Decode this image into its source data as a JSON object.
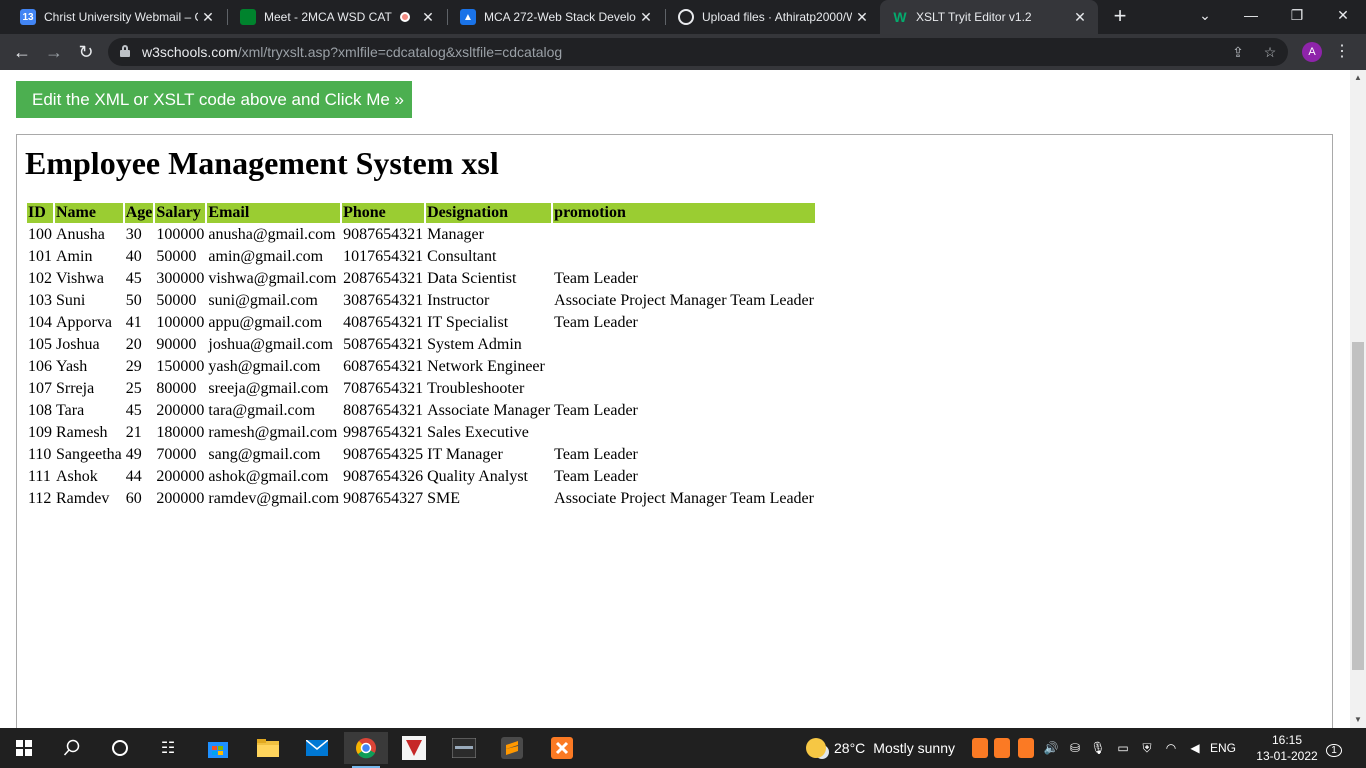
{
  "browser": {
    "tabs": [
      {
        "title": "Christ University Webmail – C",
        "favicon": "calendar-icon",
        "favicon_text": "13"
      },
      {
        "title": "Meet - 2MCA WSD CAT",
        "favicon": "meet-icon"
      },
      {
        "title": "MCA 272-Web Stack Develop",
        "favicon": "classroom-icon"
      },
      {
        "title": "Upload files · Athiratp2000/W",
        "favicon": "github-icon"
      },
      {
        "title": "XSLT Tryit Editor v1.2",
        "favicon": "w3schools-icon",
        "active": true
      }
    ],
    "url_host": "w3schools.com",
    "url_path": "/xml/tryxslt.asp?xmlfile=cdcatalog&xsltfile=cdcatalog",
    "profile_initial": "A"
  },
  "page": {
    "run_button_label": "Edit the XML or XSLT code above and Click Me »",
    "result_title": "Employee Management System xsl",
    "table": {
      "columns": [
        "ID",
        "Name",
        "Age",
        "Salary",
        "Email",
        "Phone",
        "Designation",
        "promotion"
      ],
      "rows": [
        [
          "100",
          "Anusha",
          "30",
          "100000",
          "anusha@gmail.com",
          "9087654321",
          "Manager",
          ""
        ],
        [
          "101",
          "Amin",
          "40",
          "50000",
          "amin@gmail.com",
          "1017654321",
          "Consultant",
          ""
        ],
        [
          "102",
          "Vishwa",
          "45",
          "300000",
          "vishwa@gmail.com",
          "2087654321",
          "Data Scientist",
          "Team Leader"
        ],
        [
          "103",
          "Suni",
          "50",
          "50000",
          "suni@gmail.com",
          "3087654321",
          "Instructor",
          "Associate Project Manager Team Leader"
        ],
        [
          "104",
          "Apporva",
          "41",
          "100000",
          "appu@gmail.com",
          "4087654321",
          "IT Specialist",
          "Team Leader"
        ],
        [
          "105",
          "Joshua",
          "20",
          "90000",
          "joshua@gmail.com",
          "5087654321",
          "System Admin",
          ""
        ],
        [
          "106",
          "Yash",
          "29",
          "150000",
          "yash@gmail.com",
          "6087654321",
          "Network Engineer",
          ""
        ],
        [
          "107",
          "Srreja",
          "25",
          "80000",
          "sreeja@gmail.com",
          "7087654321",
          "Troubleshooter",
          ""
        ],
        [
          "108",
          "Tara",
          "45",
          "200000",
          "tara@gmail.com",
          "8087654321",
          "Associate Manager",
          "Team Leader"
        ],
        [
          "109",
          "Ramesh",
          "21",
          "180000",
          "ramesh@gmail.com",
          "9987654321",
          "Sales Executive",
          ""
        ],
        [
          "110",
          "Sangeetha",
          "49",
          "70000",
          "sang@gmail.com",
          "9087654325",
          "IT Manager",
          "Team Leader"
        ],
        [
          "111",
          "Ashok",
          "44",
          "200000",
          "ashok@gmail.com",
          "9087654326",
          "Quality Analyst",
          "Team Leader"
        ],
        [
          "112",
          "Ramdev",
          "60",
          "200000",
          "ramdev@gmail.com",
          "9087654327",
          "SME",
          "Associate Project Manager Team Leader"
        ]
      ]
    }
  },
  "taskbar": {
    "weather_temp": "28°C",
    "weather_text": "Mostly sunny",
    "language": "ENG",
    "time": "16:15",
    "date": "13-01-2022",
    "notification_count": "1"
  },
  "colors": {
    "run_button": "#4caf50",
    "table_header": "#9acd32",
    "tab_strip": "#202124",
    "toolbar": "#35363a"
  }
}
